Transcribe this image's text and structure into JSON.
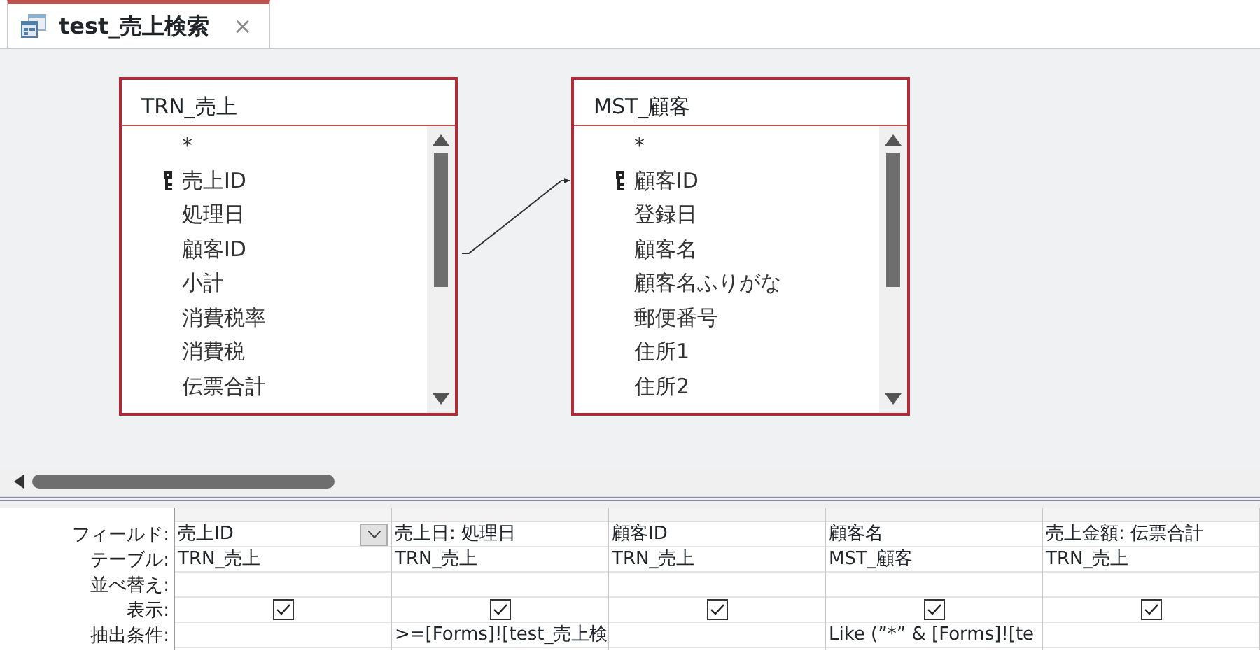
{
  "tab": {
    "title": "test_売上検索",
    "close": "×",
    "selected": true
  },
  "tables": [
    {
      "title": "TRN_売上",
      "fields": [
        {
          "name": "*",
          "key": false
        },
        {
          "name": "売上ID",
          "key": true
        },
        {
          "name": "処理日",
          "key": false
        },
        {
          "name": "顧客ID",
          "key": false
        },
        {
          "name": "小計",
          "key": false
        },
        {
          "name": "消費税率",
          "key": false
        },
        {
          "name": "消費税",
          "key": false
        },
        {
          "name": "伝票合計",
          "key": false
        }
      ]
    },
    {
      "title": "MST_顧客",
      "fields": [
        {
          "name": "*",
          "key": false
        },
        {
          "name": "顧客ID",
          "key": true
        },
        {
          "name": "登録日",
          "key": false
        },
        {
          "name": "顧客名",
          "key": false
        },
        {
          "name": "顧客名ふりがな",
          "key": false
        },
        {
          "name": "郵便番号",
          "key": false
        },
        {
          "name": "住所1",
          "key": false
        },
        {
          "name": "住所2",
          "key": false
        }
      ]
    }
  ],
  "grid": {
    "row_labels": [
      "フィールド:",
      "テーブル:",
      "並べ替え:",
      "表示:",
      "抽出条件:"
    ],
    "columns": [
      {
        "field": "売上ID",
        "table": "TRN_売上",
        "show": true,
        "selected": true
      },
      {
        "field": "売上日: 処理日",
        "table": "TRN_売上",
        "show": true,
        "criteria": ">=[Forms]![test_売上検",
        "selected": false
      },
      {
        "field": "顧客ID",
        "table": "TRN_売上",
        "show": true,
        "selected": false
      },
      {
        "field": "顧客名",
        "table": "MST_顧客",
        "show": true,
        "criteria": "Like (”*” & [Forms]![te",
        "selected": false
      },
      {
        "field": "売上金額: 伝票合計",
        "table": "TRN_売上",
        "show": true,
        "selected": false
      }
    ]
  }
}
